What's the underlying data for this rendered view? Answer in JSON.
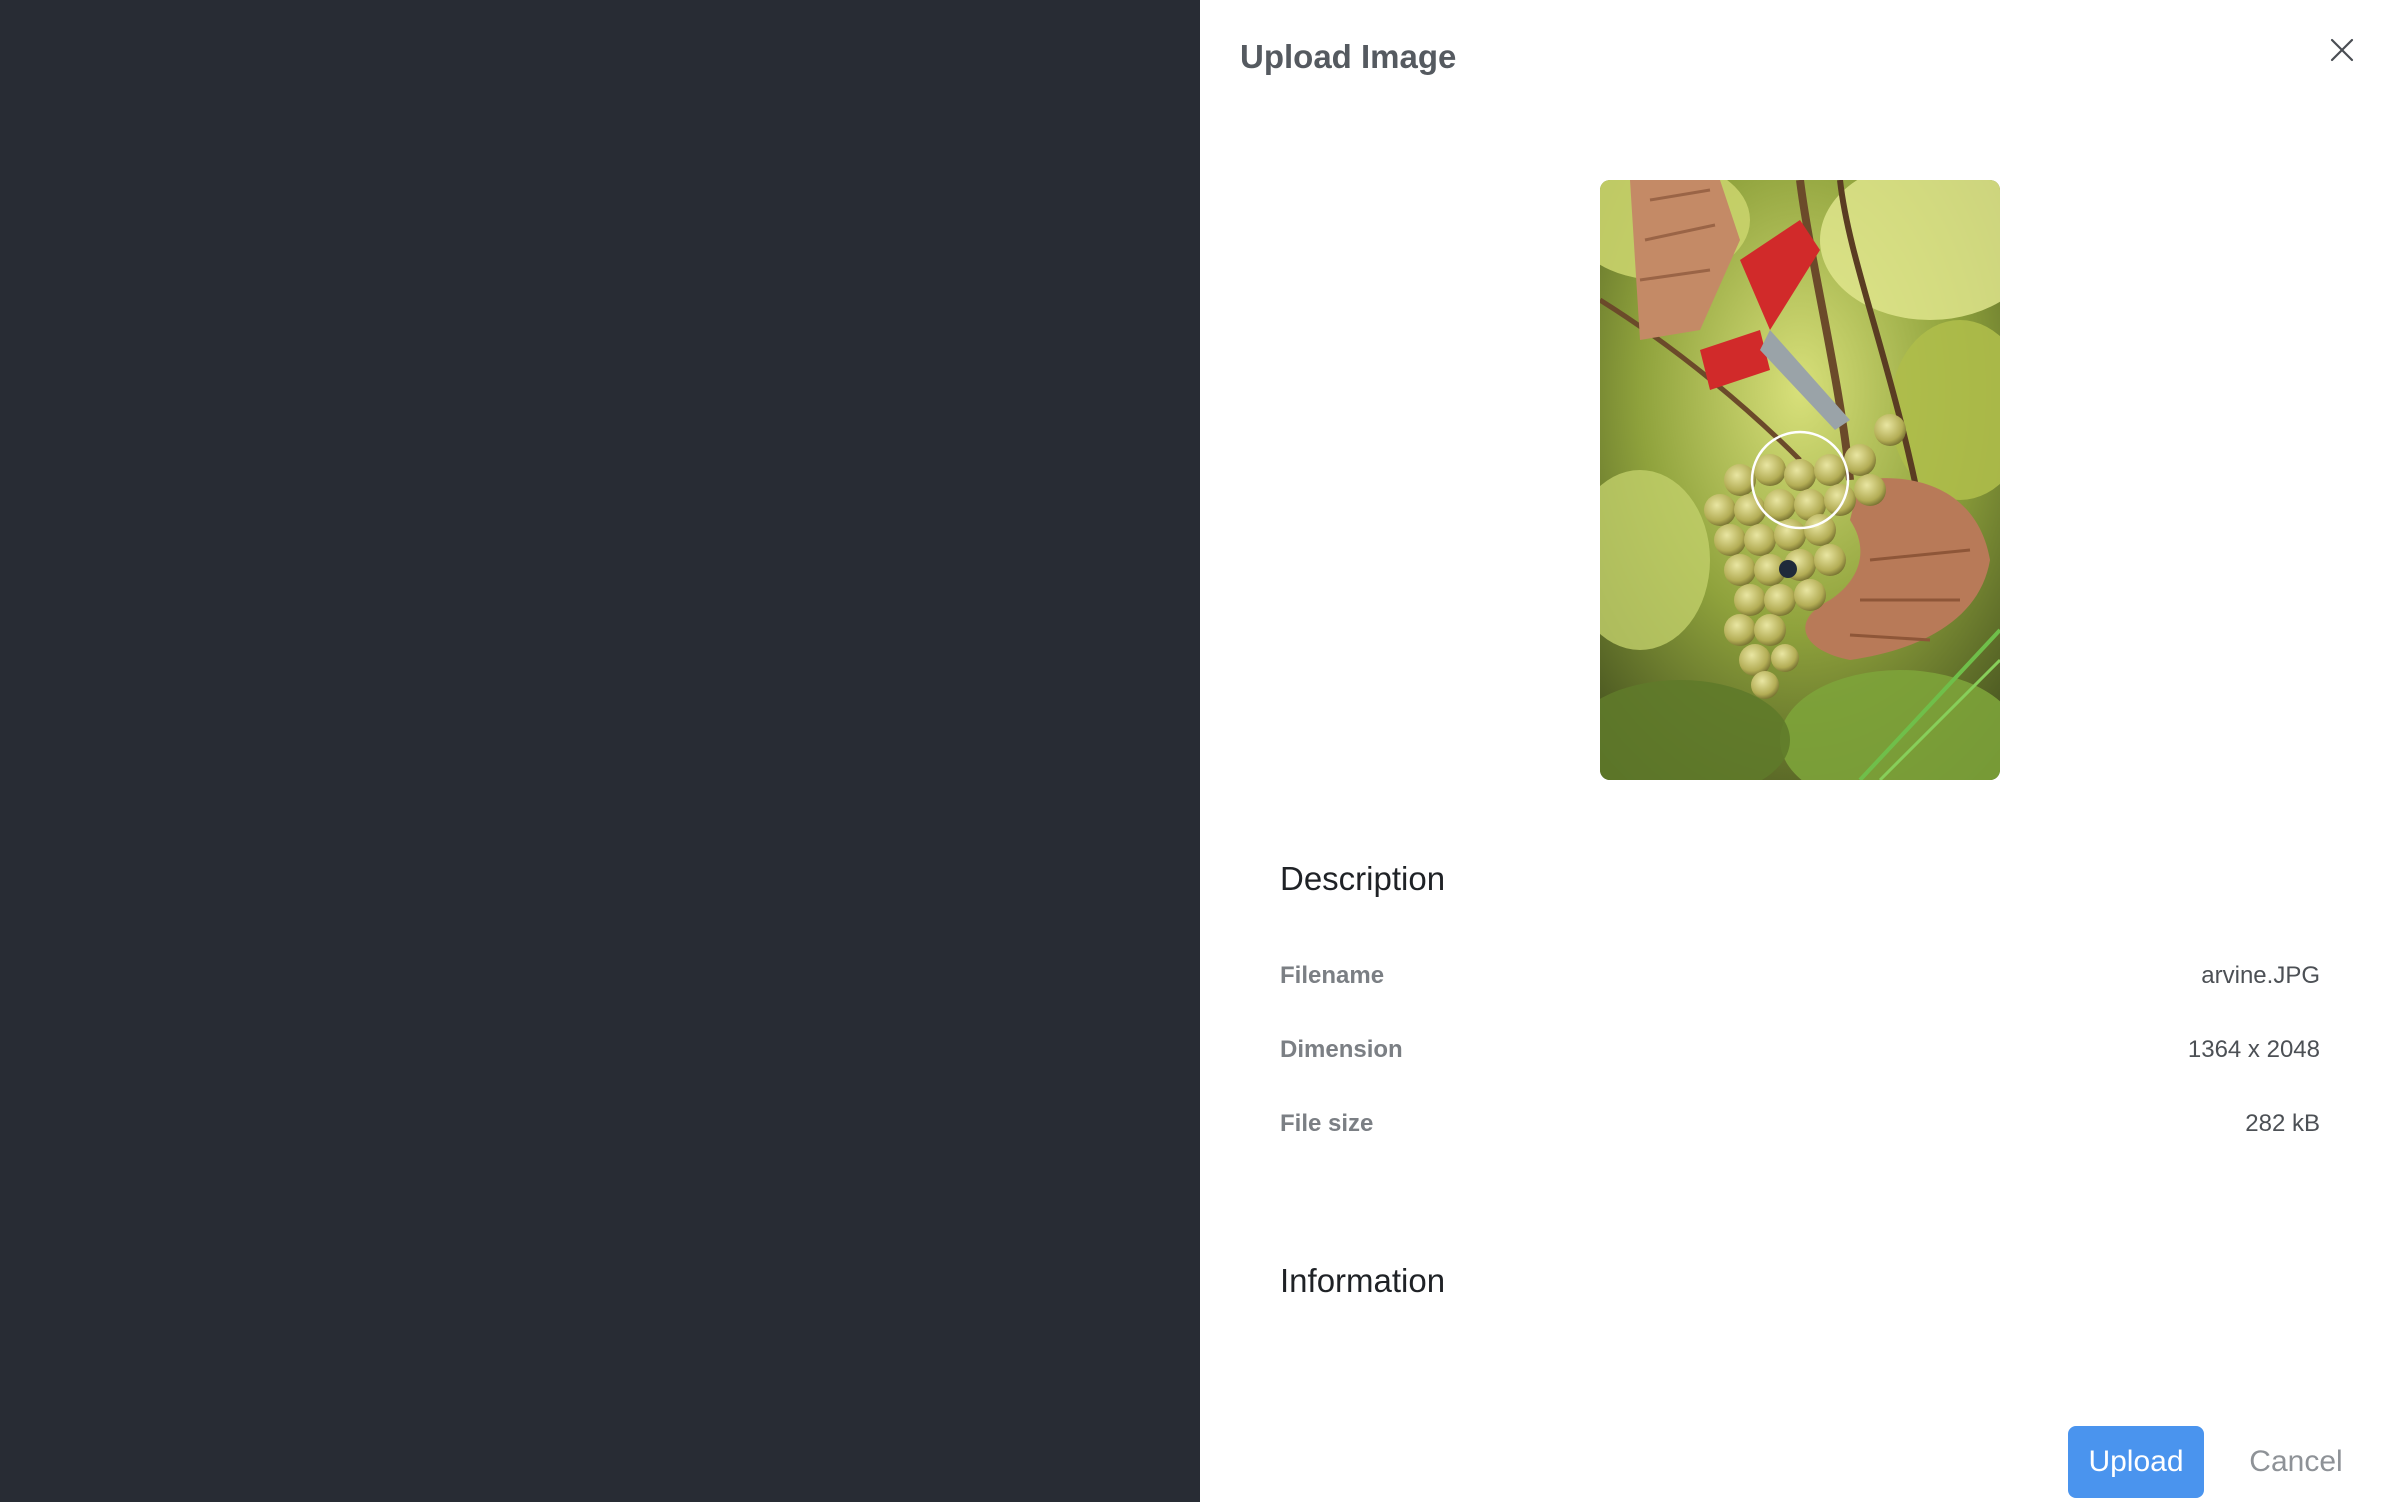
{
  "drawer": {
    "title": "Upload Image",
    "close_icon": "close-icon"
  },
  "preview": {
    "alt": "arvine.JPG",
    "focus_indicator": "circle-marker"
  },
  "description": {
    "heading": "Description",
    "rows": [
      {
        "label": "Filename",
        "value": "arvine.JPG"
      },
      {
        "label": "Dimension",
        "value": "1364 x 2048"
      },
      {
        "label": "File size",
        "value": "282 kB"
      }
    ]
  },
  "information": {
    "heading": "Information"
  },
  "actions": {
    "upload_label": "Upload",
    "cancel_label": "Cancel"
  },
  "colors": {
    "backdrop": "#282c34",
    "accent": "#4a94ee"
  }
}
